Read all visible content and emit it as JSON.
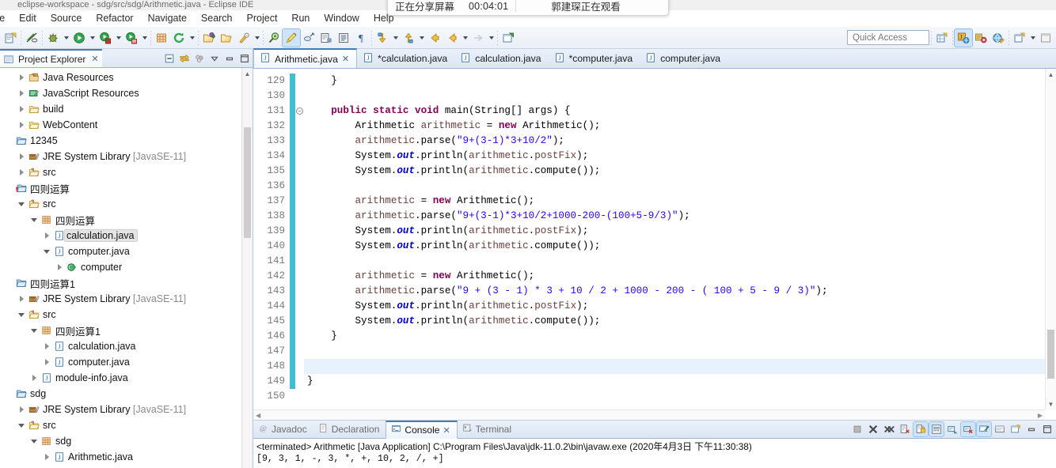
{
  "window": {
    "title": "eclipse-workspace - sdg/src/sdg/Arithmetic.java - Eclipse IDE"
  },
  "share_overlay": {
    "status": "正在分享屏幕",
    "timer": "00:04:01",
    "watcher": "郭建琛正在观看"
  },
  "menubar": {
    "items": [
      {
        "label": "File"
      },
      {
        "label": "Edit"
      },
      {
        "label": "Source"
      },
      {
        "label": "Refactor"
      },
      {
        "label": "Navigate"
      },
      {
        "label": "Search"
      },
      {
        "label": "Project"
      },
      {
        "label": "Run"
      },
      {
        "label": "Window"
      },
      {
        "label": "Help"
      }
    ]
  },
  "toolbar": {
    "quick_access_placeholder": "Quick Access",
    "items": [
      {
        "name": "new-wizard-icon"
      },
      {
        "name": "save-icon"
      },
      {
        "name": "no-marker-icon"
      },
      {
        "name": "debug-icon"
      },
      {
        "name": "run-icon"
      },
      {
        "name": "run-as-icon"
      },
      {
        "name": "coverage-icon"
      },
      {
        "name": "new-package-icon"
      },
      {
        "name": "refresh-icon"
      },
      {
        "name": "open-type-icon"
      },
      {
        "name": "open-task-icon"
      },
      {
        "name": "external-tools-icon"
      },
      {
        "name": "search-icon"
      },
      {
        "name": "pencil-icon"
      },
      {
        "name": "skip-breakpoints-icon"
      },
      {
        "name": "toggle-block-icon"
      },
      {
        "name": "show-whitespace-icon"
      },
      {
        "name": "pilcrow-icon"
      },
      {
        "name": "next-annotation-icon"
      },
      {
        "name": "previous-annotation-icon"
      },
      {
        "name": "back-icon"
      },
      {
        "name": "forward-icon"
      },
      {
        "name": "last-edit-icon"
      },
      {
        "name": "new-editor-icon"
      }
    ],
    "right_items": [
      {
        "name": "new-perspective-icon"
      },
      {
        "name": "java-perspective-icon"
      },
      {
        "name": "java-ee-perspective-icon"
      },
      {
        "name": "web-perspective-icon"
      },
      {
        "name": "open-perspective-icon"
      },
      {
        "name": "minimize-icon"
      }
    ]
  },
  "project_explorer": {
    "title": "Project Explorer",
    "close_glyph": "✕",
    "toolbar": [
      {
        "name": "collapse-all-icon"
      },
      {
        "name": "link-with-editor-icon"
      },
      {
        "name": "view-menu-dots-icon"
      },
      {
        "name": "view-menu-icon"
      },
      {
        "name": "minimize-view-icon"
      },
      {
        "name": "maximize-view-icon"
      }
    ],
    "tree": [
      {
        "label": "Java Resources",
        "indent": 1,
        "twist": "closed",
        "icon": "java-resources-icon",
        "suffix": ""
      },
      {
        "label": "JavaScript Resources",
        "indent": 1,
        "twist": "closed",
        "icon": "js-resources-icon",
        "suffix": ""
      },
      {
        "label": "build",
        "indent": 1,
        "twist": "closed",
        "icon": "folder-icon",
        "suffix": ""
      },
      {
        "label": "WebContent",
        "indent": 1,
        "twist": "closed",
        "icon": "folder-icon",
        "suffix": ""
      },
      {
        "label": "12345",
        "indent": 0,
        "twist": "none",
        "icon": "project-icon",
        "suffix": ""
      },
      {
        "label": "JRE System Library",
        "indent": 1,
        "twist": "closed",
        "icon": "library-icon",
        "suffix": " [JavaSE-11]"
      },
      {
        "label": "src",
        "indent": 1,
        "twist": "closed",
        "icon": "source-folder-icon",
        "suffix": ""
      },
      {
        "label": "四则运算",
        "indent": 0,
        "twist": "none",
        "icon": "project-error-icon",
        "suffix": ""
      },
      {
        "label": "src",
        "indent": 1,
        "twist": "open",
        "icon": "source-folder-icon",
        "suffix": ""
      },
      {
        "label": "四则运算",
        "indent": 2,
        "twist": "open",
        "icon": "package-icon",
        "suffix": ""
      },
      {
        "label": "calculation.java",
        "indent": 3,
        "twist": "closed",
        "icon": "java-file-icon",
        "suffix": "",
        "selected": true
      },
      {
        "label": "computer.java",
        "indent": 3,
        "twist": "open",
        "icon": "java-file-icon",
        "suffix": ""
      },
      {
        "label": "computer",
        "indent": 4,
        "twist": "closed",
        "icon": "class-icon",
        "suffix": ""
      },
      {
        "label": "四则运算1",
        "indent": 0,
        "twist": "none",
        "icon": "project-icon",
        "suffix": ""
      },
      {
        "label": "JRE System Library",
        "indent": 1,
        "twist": "closed",
        "icon": "library-icon",
        "suffix": " [JavaSE-11]"
      },
      {
        "label": "src",
        "indent": 1,
        "twist": "open",
        "icon": "source-folder-icon",
        "suffix": ""
      },
      {
        "label": "四则运算1",
        "indent": 2,
        "twist": "open",
        "icon": "package-icon",
        "suffix": ""
      },
      {
        "label": "calculation.java",
        "indent": 3,
        "twist": "closed",
        "icon": "java-file-icon",
        "suffix": ""
      },
      {
        "label": "computer.java",
        "indent": 3,
        "twist": "closed",
        "icon": "java-file-icon",
        "suffix": ""
      },
      {
        "label": "module-info.java",
        "indent": 2,
        "twist": "closed",
        "icon": "java-file-icon",
        "suffix": ""
      },
      {
        "label": "sdg",
        "indent": 0,
        "twist": "none",
        "icon": "project-icon",
        "suffix": ""
      },
      {
        "label": "JRE System Library",
        "indent": 1,
        "twist": "closed",
        "icon": "library-icon",
        "suffix": " [JavaSE-11]"
      },
      {
        "label": "src",
        "indent": 1,
        "twist": "open",
        "icon": "source-folder-icon",
        "suffix": ""
      },
      {
        "label": "sdg",
        "indent": 2,
        "twist": "open",
        "icon": "package-icon",
        "suffix": ""
      },
      {
        "label": "Arithmetic.java",
        "indent": 3,
        "twist": "closed",
        "icon": "java-file-icon",
        "suffix": ""
      }
    ]
  },
  "editor": {
    "tabs": [
      {
        "label": "Arithmetic.java",
        "selected": true,
        "dirty": false
      },
      {
        "label": "*calculation.java",
        "selected": false,
        "dirty": true
      },
      {
        "label": "calculation.java",
        "selected": false,
        "dirty": false
      },
      {
        "label": "*computer.java",
        "selected": false,
        "dirty": true
      },
      {
        "label": "computer.java",
        "selected": false,
        "dirty": false
      }
    ],
    "first_line": 129,
    "current_line": 148,
    "lines": [
      {
        "n": 129,
        "fold": false,
        "tokens": [
          {
            "t": "    }",
            "c": "plain"
          }
        ]
      },
      {
        "n": 130,
        "fold": false,
        "tokens": []
      },
      {
        "n": 131,
        "fold": true,
        "tokens": [
          {
            "t": "    ",
            "c": "plain"
          },
          {
            "t": "public static void ",
            "c": "kw"
          },
          {
            "t": "main(String[] args) {",
            "c": "plain"
          }
        ]
      },
      {
        "n": 132,
        "fold": false,
        "tokens": [
          {
            "t": "        Arithmetic ",
            "c": "plain"
          },
          {
            "t": "arithmetic",
            "c": "ident"
          },
          {
            "t": " = ",
            "c": "plain"
          },
          {
            "t": "new",
            "c": "kw"
          },
          {
            "t": " Arithmetic();",
            "c": "plain"
          }
        ]
      },
      {
        "n": 133,
        "fold": false,
        "tokens": [
          {
            "t": "        ",
            "c": "plain"
          },
          {
            "t": "arithmetic",
            "c": "ident"
          },
          {
            "t": ".parse(",
            "c": "plain"
          },
          {
            "t": "\"9+(3-1)*3+10/2\"",
            "c": "str"
          },
          {
            "t": ");",
            "c": "plain"
          }
        ]
      },
      {
        "n": 134,
        "fold": false,
        "tokens": [
          {
            "t": "        System.",
            "c": "plain"
          },
          {
            "t": "out",
            "c": "fld"
          },
          {
            "t": ".println(",
            "c": "plain"
          },
          {
            "t": "arithmetic",
            "c": "ident"
          },
          {
            "t": ".",
            "c": "plain"
          },
          {
            "t": "postFix",
            "c": "ident"
          },
          {
            "t": ");",
            "c": "plain"
          }
        ]
      },
      {
        "n": 135,
        "fold": false,
        "tokens": [
          {
            "t": "        System.",
            "c": "plain"
          },
          {
            "t": "out",
            "c": "fld"
          },
          {
            "t": ".println(",
            "c": "plain"
          },
          {
            "t": "arithmetic",
            "c": "ident"
          },
          {
            "t": ".compute());",
            "c": "plain"
          }
        ]
      },
      {
        "n": 136,
        "fold": false,
        "tokens": []
      },
      {
        "n": 137,
        "fold": false,
        "tokens": [
          {
            "t": "        ",
            "c": "plain"
          },
          {
            "t": "arithmetic",
            "c": "ident"
          },
          {
            "t": " = ",
            "c": "plain"
          },
          {
            "t": "new",
            "c": "kw"
          },
          {
            "t": " Arithmetic();",
            "c": "plain"
          }
        ]
      },
      {
        "n": 138,
        "fold": false,
        "tokens": [
          {
            "t": "        ",
            "c": "plain"
          },
          {
            "t": "arithmetic",
            "c": "ident"
          },
          {
            "t": ".parse(",
            "c": "plain"
          },
          {
            "t": "\"9+(3-1)*3+10/2+1000-200-(100+5-9/3)\"",
            "c": "str"
          },
          {
            "t": ");",
            "c": "plain"
          }
        ]
      },
      {
        "n": 139,
        "fold": false,
        "tokens": [
          {
            "t": "        System.",
            "c": "plain"
          },
          {
            "t": "out",
            "c": "fld"
          },
          {
            "t": ".println(",
            "c": "plain"
          },
          {
            "t": "arithmetic",
            "c": "ident"
          },
          {
            "t": ".",
            "c": "plain"
          },
          {
            "t": "postFix",
            "c": "ident"
          },
          {
            "t": ");",
            "c": "plain"
          }
        ]
      },
      {
        "n": 140,
        "fold": false,
        "tokens": [
          {
            "t": "        System.",
            "c": "plain"
          },
          {
            "t": "out",
            "c": "fld"
          },
          {
            "t": ".println(",
            "c": "plain"
          },
          {
            "t": "arithmetic",
            "c": "ident"
          },
          {
            "t": ".compute());",
            "c": "plain"
          }
        ]
      },
      {
        "n": 141,
        "fold": false,
        "tokens": []
      },
      {
        "n": 142,
        "fold": false,
        "tokens": [
          {
            "t": "        ",
            "c": "plain"
          },
          {
            "t": "arithmetic",
            "c": "ident"
          },
          {
            "t": " = ",
            "c": "plain"
          },
          {
            "t": "new",
            "c": "kw"
          },
          {
            "t": " Arithmetic();",
            "c": "plain"
          }
        ]
      },
      {
        "n": 143,
        "fold": false,
        "tokens": [
          {
            "t": "        ",
            "c": "plain"
          },
          {
            "t": "arithmetic",
            "c": "ident"
          },
          {
            "t": ".parse(",
            "c": "plain"
          },
          {
            "t": "\"9 + (3 - 1) * 3 + 10 / 2 + 1000 - 200 - ( 100 + 5 - 9 / 3)\"",
            "c": "str"
          },
          {
            "t": ");",
            "c": "plain"
          }
        ]
      },
      {
        "n": 144,
        "fold": false,
        "tokens": [
          {
            "t": "        System.",
            "c": "plain"
          },
          {
            "t": "out",
            "c": "fld"
          },
          {
            "t": ".println(",
            "c": "plain"
          },
          {
            "t": "arithmetic",
            "c": "ident"
          },
          {
            "t": ".",
            "c": "plain"
          },
          {
            "t": "postFix",
            "c": "ident"
          },
          {
            "t": ");",
            "c": "plain"
          }
        ]
      },
      {
        "n": 145,
        "fold": false,
        "tokens": [
          {
            "t": "        System.",
            "c": "plain"
          },
          {
            "t": "out",
            "c": "fld"
          },
          {
            "t": ".println(",
            "c": "plain"
          },
          {
            "t": "arithmetic",
            "c": "ident"
          },
          {
            "t": ".compute());",
            "c": "plain"
          }
        ]
      },
      {
        "n": 146,
        "fold": false,
        "tokens": [
          {
            "t": "    }",
            "c": "plain"
          }
        ]
      },
      {
        "n": 147,
        "fold": false,
        "tokens": []
      },
      {
        "n": 148,
        "fold": false,
        "tokens": []
      },
      {
        "n": 149,
        "fold": false,
        "tokens": [
          {
            "t": "}",
            "c": "plain"
          }
        ]
      },
      {
        "n": 150,
        "fold": false,
        "tokens": []
      }
    ]
  },
  "console": {
    "tabs": [
      {
        "label": "Javadoc",
        "icon": "javadoc-icon",
        "selected": false
      },
      {
        "label": "Declaration",
        "icon": "declaration-icon",
        "selected": false
      },
      {
        "label": "Console",
        "icon": "console-icon",
        "selected": true
      },
      {
        "label": "Terminal",
        "icon": "terminal-icon",
        "selected": false
      }
    ],
    "close_glyph": "✕",
    "toolbar": [
      {
        "name": "terminate-icon",
        "on": false
      },
      {
        "name": "remove-launch-icon",
        "on": false
      },
      {
        "name": "remove-all-terminated-icon",
        "on": false
      },
      {
        "name": "clear-console-icon",
        "on": false
      },
      {
        "name": "scroll-lock-icon",
        "on": true
      },
      {
        "name": "word-wrap-icon",
        "on": true
      },
      {
        "name": "show-console-on-output-icon",
        "on": false
      },
      {
        "name": "show-console-on-error-icon",
        "on": true
      },
      {
        "name": "pin-console-icon",
        "on": true
      },
      {
        "name": "display-selected-console-icon",
        "on": false
      },
      {
        "name": "open-console-icon",
        "on": false
      },
      {
        "name": "minimize-console-icon",
        "on": false
      },
      {
        "name": "maximize-console-icon",
        "on": false
      }
    ],
    "header": "<terminated> Arithmetic [Java Application] C:\\Program Files\\Java\\jdk-11.0.2\\bin\\javaw.exe (2020年4月3日 下午11:30:38)",
    "output_lines": [
      "[9, 3, 1, -, 3, *, +, 10, 2, /, +]"
    ]
  },
  "colors": {
    "accent": "#3f7fbf",
    "keyword": "#7f0055",
    "string": "#2a00ff",
    "field": "#0000c0",
    "current_line": "#e8f2fd",
    "change_bar": "#3fbfd0",
    "toolbar_bg": "#eaeff7"
  }
}
